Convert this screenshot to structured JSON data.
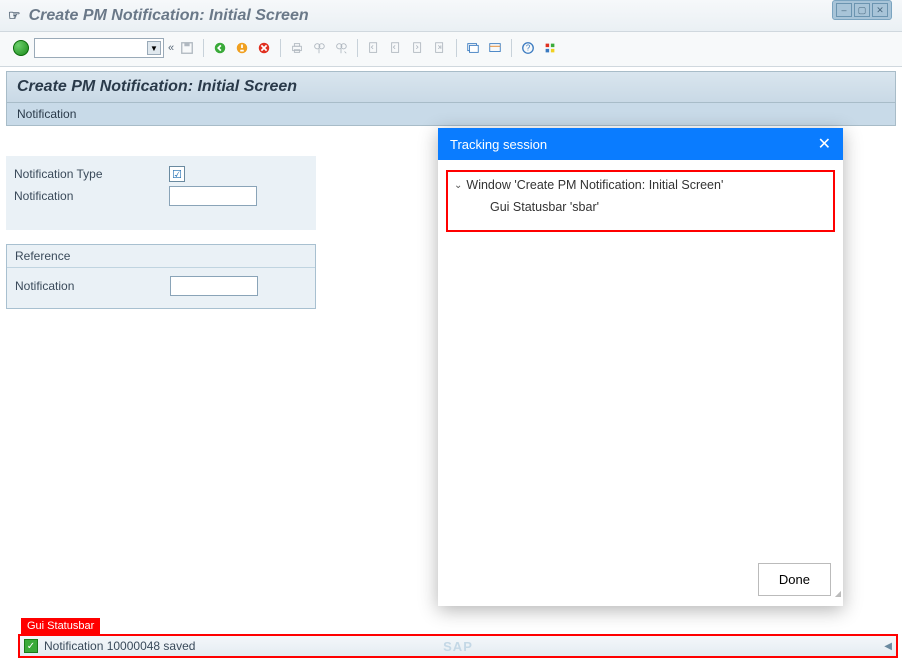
{
  "window": {
    "title": "Create PM Notification: Initial Screen"
  },
  "toolbar": {
    "chevrons": "«"
  },
  "page": {
    "header": "Create PM Notification: Initial Screen",
    "subheader": "Notification"
  },
  "form": {
    "notification_type_label": "Notification Type",
    "notification_label": "Notification",
    "notification_value": ""
  },
  "reference": {
    "legend": "Reference",
    "notification_label": "Notification",
    "notification_value": ""
  },
  "statusbar": {
    "annotation": "Gui Statusbar",
    "message": "Notification 10000048 saved",
    "logo": "SAP"
  },
  "popup": {
    "title": "Tracking session",
    "tree_window": "Window 'Create PM Notification: Initial Screen'",
    "tree_status": "Gui Statusbar 'sbar'",
    "done": "Done"
  }
}
